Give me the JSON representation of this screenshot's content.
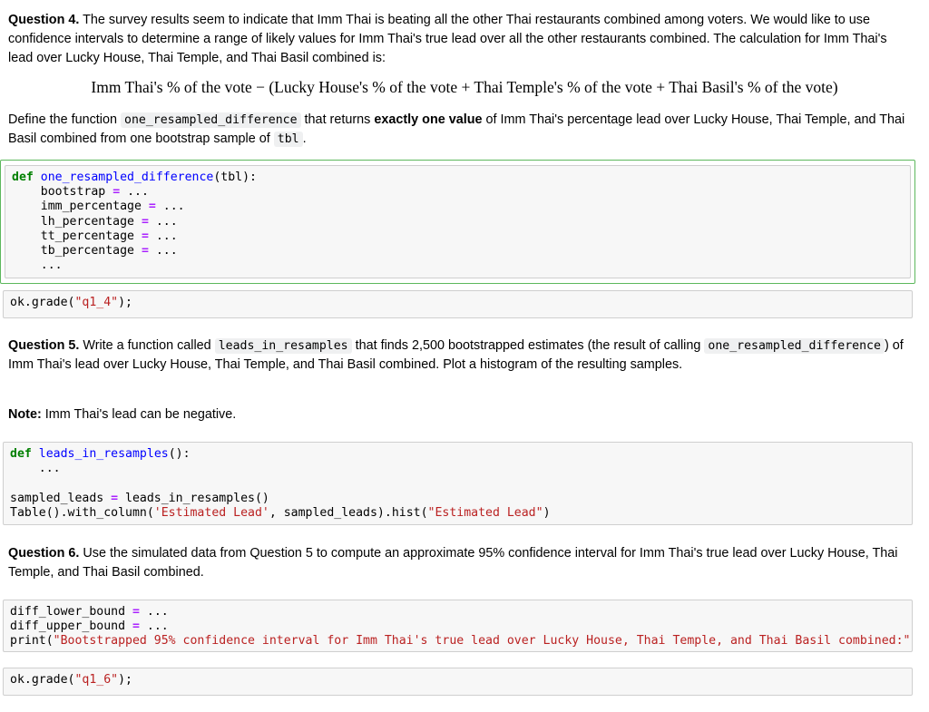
{
  "q4": {
    "heading": "Question 4.",
    "text": " The survey results seem to indicate that Imm Thai is beating all the other Thai restaurants combined among voters. We would like to use confidence intervals to determine a range of likely values for Imm Thai's true lead over all the other restaurants combined. The calculation for Imm Thai's lead over Lucky House, Thai Temple, and Thai Basil combined is:",
    "formula": "Imm Thai's % of the vote − (Lucky House's % of the vote + Thai Temple's % of the vote + Thai Basil's % of the vote)",
    "define_pre": "Define the function ",
    "define_code": "one_resampled_difference",
    "define_mid": " that returns ",
    "define_bold": "exactly one value",
    "define_post": " of Imm Thai's percentage lead over Lucky House, Thai Temple, and Thai Basil combined from one bootstrap sample of ",
    "define_code2": "tbl",
    "define_end": "."
  },
  "cell1": {
    "kw": "def",
    "fname": "one_resampled_difference",
    "sig": "(tbl):",
    "vars": [
      "bootstrap",
      "imm_percentage",
      "lh_percentage",
      "tt_percentage",
      "tb_percentage"
    ],
    "eq": "=",
    "ellipsis": "...",
    "body_indent": "    ",
    "last": "..."
  },
  "cell2": {
    "pre": "ok.grade(",
    "str": "\"q1_4\"",
    "post": ");"
  },
  "q5": {
    "heading": "Question 5.",
    "t1": " Write a function called ",
    "code1": "leads_in_resamples",
    "t2": " that finds 2,500 bootstrapped estimates (the result of calling ",
    "code2": "one_resampled_difference",
    "t3": ") of Imm Thai's lead over Lucky House, Thai Temple, and Thai Basil combined. Plot a histogram of the resulting samples.",
    "note_label": "Note:",
    "note_text": " Imm Thai's lead can be negative."
  },
  "cell3": {
    "kw": "def",
    "fname": "leads_in_resamples",
    "sig": "():",
    "body": "...",
    "line3_a": "sampled_leads ",
    "eq": "=",
    "line3_b": " leads_in_resamples()",
    "line4_a": "Table().with_column(",
    "line4_s1": "'Estimated Lead'",
    "line4_b": ", sampled_leads).hist(",
    "line4_s2": "\"Estimated Lead\"",
    "line4_c": ")"
  },
  "q6": {
    "heading": "Question 6.",
    "text": " Use the simulated data from Question 5 to compute an approximate 95% confidence interval for Imm Thai's true lead over Lucky House, Thai Temple, and Thai Basil combined."
  },
  "cell4": {
    "l1a": "diff_lower_bound ",
    "l2a": "diff_upper_bound ",
    "eq": "=",
    "ell": " ...",
    "l3a": "print(",
    "l3s": "\"Bootstrapped 95% confidence interval for Imm Thai's true lead over Lucky House, Thai Temple, and Thai Basil combined:\""
  },
  "cell5": {
    "pre": "ok.grade(",
    "str": "\"q1_6\"",
    "post": ");"
  }
}
